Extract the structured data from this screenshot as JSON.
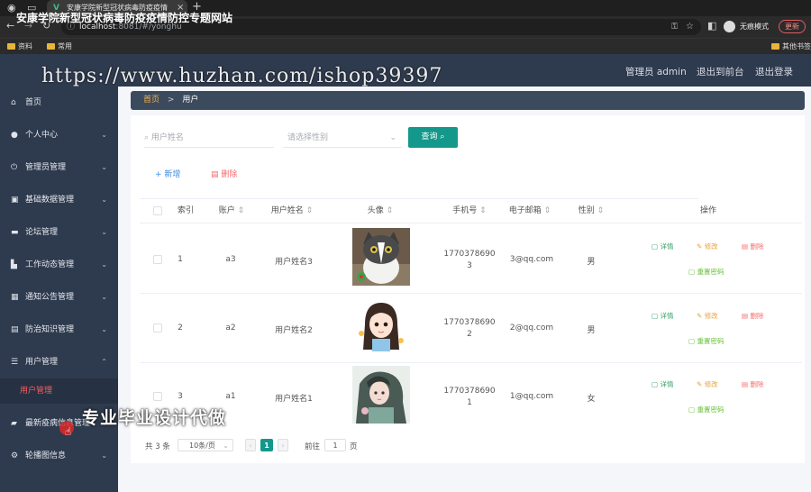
{
  "browser": {
    "tab_title": "安康学院新型冠状病毒防疫疫情",
    "url_host": "localhost",
    "url_path": ":8081/#/yonghu",
    "profile_label": "无痕模式",
    "update_label": "更新",
    "bookmarks": [
      "资料",
      "常用"
    ],
    "other_bookmarks": "其他书签"
  },
  "header": {
    "site_title": "安康学院新型冠状病毒防疫疫情防控专题网站",
    "user_label": "管理员 admin",
    "back_label": "退出到前台",
    "logout_label": "退出登录"
  },
  "watermark": {
    "url": "https://www.huzhan.com/ishop39397",
    "banner": "专业毕业设计代做"
  },
  "sidebar": {
    "items": [
      {
        "label": "首页",
        "icon": "home-icon",
        "expandable": false
      },
      {
        "label": "个人中心",
        "icon": "user-icon",
        "expandable": true
      },
      {
        "label": "管理员管理",
        "icon": "power-icon",
        "expandable": true
      },
      {
        "label": "基础数据管理",
        "icon": "data-icon",
        "expandable": true
      },
      {
        "label": "论坛管理",
        "icon": "forum-icon",
        "expandable": true
      },
      {
        "label": "工作动态管理",
        "icon": "work-icon",
        "expandable": true
      },
      {
        "label": "通知公告管理",
        "icon": "grid-icon",
        "expandable": true
      },
      {
        "label": "防治知识管理",
        "icon": "book-icon",
        "expandable": true
      },
      {
        "label": "用户管理",
        "icon": "sliders-icon",
        "expandable": true,
        "expanded": true
      },
      {
        "label": "最新疫病信息管理",
        "icon": "briefcase-icon",
        "expandable": true
      },
      {
        "label": "轮播图信息",
        "icon": "settings-icon",
        "expandable": true
      }
    ],
    "sub_active": "用户管理"
  },
  "breadcrumb": {
    "home": "首页",
    "separator": ">",
    "current": "用户"
  },
  "search": {
    "name_placeholder": "用户姓名",
    "gender_placeholder": "请选择性别",
    "query_label": "查询"
  },
  "toolbar": {
    "add_label": "新增",
    "delete_label": "删除"
  },
  "table": {
    "headers": [
      "索引",
      "账户",
      "用户姓名",
      "头像",
      "手机号",
      "电子邮箱",
      "性别",
      "操作"
    ],
    "rows": [
      {
        "index": "1",
        "account": "a3",
        "name": "用户姓名3",
        "phone_a": "1770378690",
        "phone_b": "3",
        "email": "3@qq.com",
        "gender": "男"
      },
      {
        "index": "2",
        "account": "a2",
        "name": "用户姓名2",
        "phone_a": "1770378690",
        "phone_b": "2",
        "email": "2@qq.com",
        "gender": "男"
      },
      {
        "index": "3",
        "account": "a1",
        "name": "用户姓名1",
        "phone_a": "1770378690",
        "phone_b": "1",
        "email": "1@qq.com",
        "gender": "女"
      }
    ],
    "actions": {
      "detail": "详情",
      "edit": "修改",
      "delete": "删除",
      "reset": "重置密码"
    }
  },
  "pagination": {
    "total": "共 3 条",
    "page_size": "10条/页",
    "current_page": "1",
    "goto_label": "前往",
    "goto_value": "1",
    "page_suffix": "页"
  },
  "colors": {
    "sidebar_bg": "#2e3a4d",
    "accent": "#14988b",
    "danger": "#f56c6c",
    "warning": "#e6a23c",
    "success": "#67c23a"
  }
}
